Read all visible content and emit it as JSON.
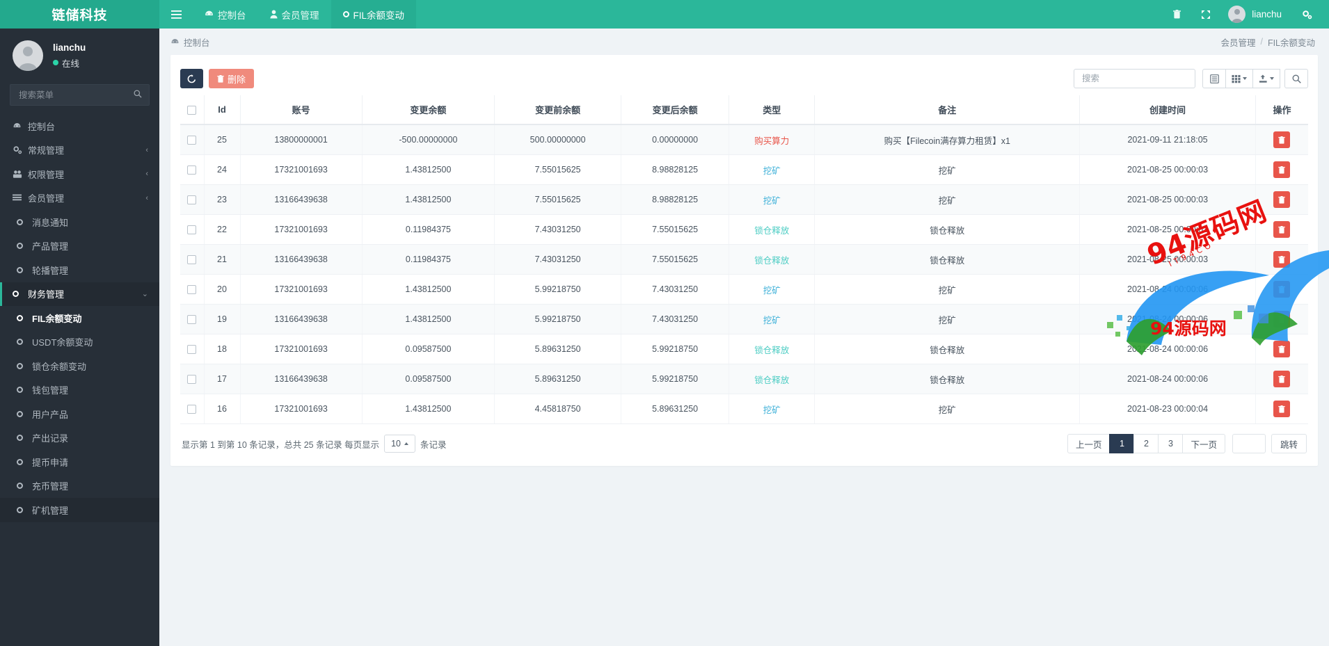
{
  "navbar": {
    "brand": "链储科技",
    "menu_icon": "hamburger-icon",
    "tabs": [
      {
        "label": "控制台",
        "icon": "dashboard-icon",
        "active": false
      },
      {
        "label": "会员管理",
        "icon": "user-icon",
        "active": false
      },
      {
        "label": "FIL余额变动",
        "icon": "circle-icon",
        "active": true
      }
    ],
    "right_icons": [
      {
        "name": "trash-icon",
        "glyph": "🗑"
      },
      {
        "name": "fullscreen-icon",
        "glyph": "⤢"
      }
    ],
    "user": "lianchu",
    "settings_icon": "gear-icon"
  },
  "sidebar": {
    "user_name": "lianchu",
    "user_status": "在线",
    "search_placeholder": "搜索菜单",
    "search_value": "",
    "search_icon": "search-icon",
    "items": [
      {
        "label": "控制台",
        "icon": "dashboard-icon",
        "type": "top",
        "arrow": "",
        "state": ""
      },
      {
        "label": "常规管理",
        "icon": "gears-icon",
        "type": "top",
        "arrow": "‹",
        "state": ""
      },
      {
        "label": "权限管理",
        "icon": "users-icon",
        "type": "top",
        "arrow": "‹",
        "state": ""
      },
      {
        "label": "会员管理",
        "icon": "list-icon",
        "type": "top",
        "arrow": "‹",
        "state": ""
      },
      {
        "label": "消息通知",
        "icon": "ring-icon",
        "type": "sub",
        "arrow": "",
        "state": ""
      },
      {
        "label": "产品管理",
        "icon": "ring-icon",
        "type": "sub",
        "arrow": "",
        "state": ""
      },
      {
        "label": "轮播管理",
        "icon": "ring-icon",
        "type": "sub",
        "arrow": "",
        "state": ""
      },
      {
        "label": "财务管理",
        "icon": "ring-icon",
        "type": "top",
        "arrow": "⌄",
        "state": "open"
      },
      {
        "label": "FIL余额变动",
        "icon": "ring-icon",
        "type": "sub",
        "arrow": "",
        "state": "active"
      },
      {
        "label": "USDT余额变动",
        "icon": "ring-icon",
        "type": "sub",
        "arrow": "",
        "state": ""
      },
      {
        "label": "锁仓余额变动",
        "icon": "ring-icon",
        "type": "sub",
        "arrow": "",
        "state": ""
      },
      {
        "label": "钱包管理",
        "icon": "ring-icon",
        "type": "sub",
        "arrow": "",
        "state": ""
      },
      {
        "label": "用户产品",
        "icon": "ring-icon",
        "type": "sub",
        "arrow": "",
        "state": ""
      },
      {
        "label": "产出记录",
        "icon": "ring-icon",
        "type": "sub",
        "arrow": "",
        "state": ""
      },
      {
        "label": "提币申请",
        "icon": "ring-icon",
        "type": "sub",
        "arrow": "",
        "state": ""
      },
      {
        "label": "充币管理",
        "icon": "ring-icon",
        "type": "sub",
        "arrow": "",
        "state": ""
      },
      {
        "label": "矿机管理",
        "icon": "ring-icon",
        "type": "sub",
        "arrow": "",
        "state": "hl"
      }
    ]
  },
  "breadcrumb": {
    "left_icon": "dashboard-icon",
    "left": "控制台",
    "right_parent": "会员管理",
    "separator": "/",
    "right_current": "FIL余额变动"
  },
  "toolbar": {
    "refresh_icon": "refresh-icon",
    "delete_label": "删除",
    "delete_icon": "trash-icon",
    "search_placeholder": "搜索",
    "search_value": "",
    "buttons": [
      {
        "name": "columns-toggle-button",
        "icon": "list-alt-icon",
        "caret": false
      },
      {
        "name": "grid-view-button",
        "icon": "grid-icon",
        "caret": true
      },
      {
        "name": "export-button",
        "icon": "export-icon",
        "caret": true
      }
    ],
    "search_button_icon": "search-icon"
  },
  "table": {
    "select_all_checkbox": false,
    "columns": [
      "",
      "Id",
      "账号",
      "变更余额",
      "变更前余额",
      "变更后余额",
      "类型",
      "备注",
      "创建时间",
      "操作"
    ],
    "delete_row_icon": "trash-icon",
    "rows": [
      {
        "id": "25",
        "account": "13800000001",
        "change": "-500.00000000",
        "before": "500.00000000",
        "after": "0.00000000",
        "type": "购买算力",
        "type_class": "type-buy",
        "remark": "购买【Filecoin满存算力租赁】x1",
        "created": "2021-09-11 21:18:05"
      },
      {
        "id": "24",
        "account": "17321001693",
        "change": "1.43812500",
        "before": "7.55015625",
        "after": "8.98828125",
        "type": "挖矿",
        "type_class": "type-mine",
        "remark": "挖矿",
        "created": "2021-08-25 00:00:03"
      },
      {
        "id": "23",
        "account": "13166439638",
        "change": "1.43812500",
        "before": "7.55015625",
        "after": "8.98828125",
        "type": "挖矿",
        "type_class": "type-mine",
        "remark": "挖矿",
        "created": "2021-08-25 00:00:03"
      },
      {
        "id": "22",
        "account": "17321001693",
        "change": "0.11984375",
        "before": "7.43031250",
        "after": "7.55015625",
        "type": "锁仓释放",
        "type_class": "type-unlock",
        "remark": "锁仓释放",
        "created": "2021-08-25 00:00:03"
      },
      {
        "id": "21",
        "account": "13166439638",
        "change": "0.11984375",
        "before": "7.43031250",
        "after": "7.55015625",
        "type": "锁仓释放",
        "type_class": "type-unlock",
        "remark": "锁仓释放",
        "created": "2021-08-25 00:00:03"
      },
      {
        "id": "20",
        "account": "17321001693",
        "change": "1.43812500",
        "before": "5.99218750",
        "after": "7.43031250",
        "type": "挖矿",
        "type_class": "type-mine",
        "remark": "挖矿",
        "created": "2021-08-24 00:00:06"
      },
      {
        "id": "19",
        "account": "13166439638",
        "change": "1.43812500",
        "before": "5.99218750",
        "after": "7.43031250",
        "type": "挖矿",
        "type_class": "type-mine",
        "remark": "挖矿",
        "created": "2021-08-24 00:00:06"
      },
      {
        "id": "18",
        "account": "17321001693",
        "change": "0.09587500",
        "before": "5.89631250",
        "after": "5.99218750",
        "type": "锁仓释放",
        "type_class": "type-unlock",
        "remark": "锁仓释放",
        "created": "2021-08-24 00:00:06"
      },
      {
        "id": "17",
        "account": "13166439638",
        "change": "0.09587500",
        "before": "5.89631250",
        "after": "5.99218750",
        "type": "锁仓释放",
        "type_class": "type-unlock",
        "remark": "锁仓释放",
        "created": "2021-08-24 00:00:06"
      },
      {
        "id": "16",
        "account": "17321001693",
        "change": "1.43812500",
        "before": "4.45818750",
        "after": "5.89631250",
        "type": "挖矿",
        "type_class": "type-mine",
        "remark": "挖矿",
        "created": "2021-08-23 00:00:04"
      }
    ]
  },
  "footer": {
    "info_prefix": "显示第 1 到第 10 条记录，总共 25 条记录 每页显示",
    "page_size": "10",
    "info_suffix": "条记录",
    "prev_label": "上一页",
    "pages": [
      "1",
      "2",
      "3"
    ],
    "current_page": "1",
    "next_label": "下一页",
    "jump_value": "",
    "jump_label": "跳转"
  },
  "watermark": {
    "main": "94源码网",
    "secondary": "94源码网",
    "sub": "IT94CO"
  }
}
